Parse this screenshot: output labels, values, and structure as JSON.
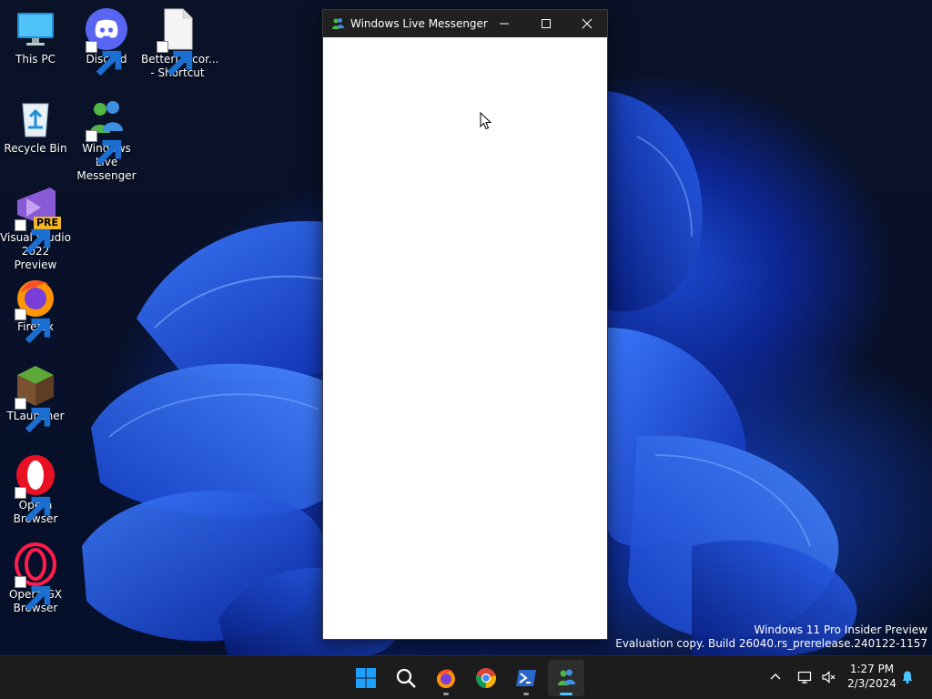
{
  "desktop": {
    "icons": [
      {
        "label": "This PC"
      },
      {
        "label": "Discord"
      },
      {
        "label": "BetterDiscor...\n- Shortcut"
      },
      {
        "label": "Recycle Bin"
      },
      {
        "label": "Windows Live\nMessenger"
      },
      {
        "label": "Visual Studio\n2022 Preview"
      },
      {
        "label": "Firefox"
      },
      {
        "label": "TLauncher"
      },
      {
        "label": "Opera\nBrowser"
      },
      {
        "label": "Opera GX\nBrowser"
      }
    ],
    "vs_badge": "PRE",
    "watermark": {
      "line1": "Windows 11 Pro Insider Preview",
      "line2": "Evaluation copy. Build 26040.rs_prerelease.240122-1157"
    }
  },
  "window": {
    "title": "Windows Live Messenger",
    "titlebar_color": "#202020",
    "content_color": "#ffffff"
  },
  "taskbar": {
    "apps": [
      "start-icon",
      "search-icon",
      "firefox-icon",
      "chrome-icon",
      "powershell-icon",
      "messenger-icon"
    ],
    "active_app": "messenger-icon",
    "clock": {
      "time": "1:27 PM",
      "date": "2/3/2024"
    },
    "accent": "#4cc2ff"
  }
}
